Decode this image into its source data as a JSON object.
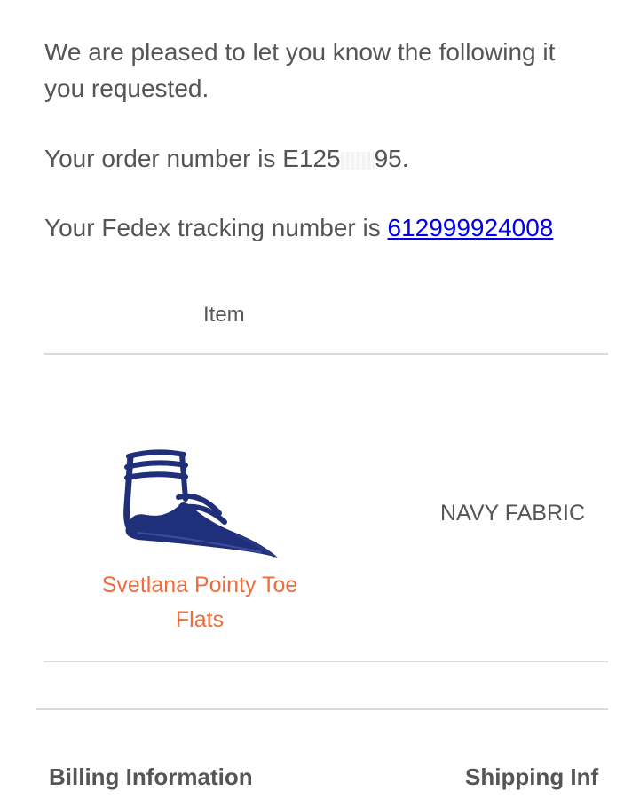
{
  "message": {
    "intro": "We are pleased to let you know the following it you requested.",
    "intro_line1": "We are pleased to let you know the following it",
    "intro_line2": "you requested.",
    "order_prefix": "Your order number is E125",
    "order_suffix": "95.",
    "tracking_prefix": "Your Fedex tracking number is",
    "tracking_number": "612999924008"
  },
  "table": {
    "item_header": "Item",
    "rows": [
      {
        "product_name": "Svetlana Pointy Toe Flats",
        "variant": "NAVY FABRIC",
        "image_icon": "navy-pointy-toe-flat-shoe-image"
      }
    ]
  },
  "footer": {
    "billing_title": "Billing Information",
    "shipping_title": "Shipping Inf"
  },
  "colors": {
    "text": "#555555",
    "link": "#0000ee",
    "product_link": "#ef6c3c",
    "divider": "#d9d9d9",
    "shoe": "#1f2f7a"
  }
}
